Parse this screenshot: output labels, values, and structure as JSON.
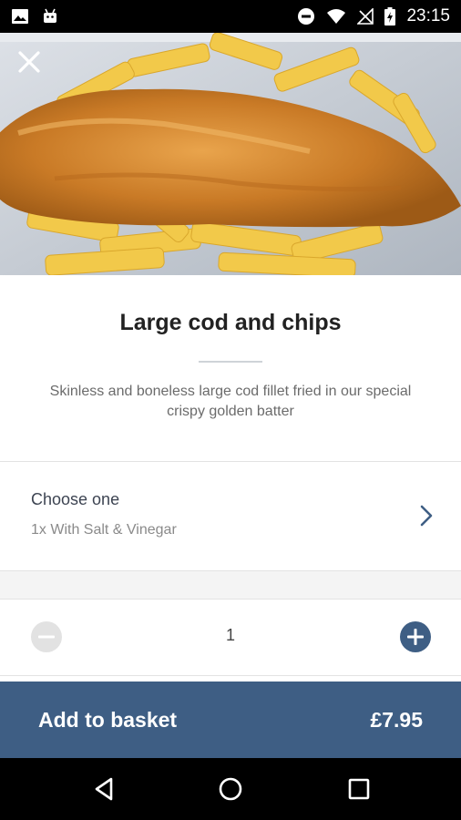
{
  "status_bar": {
    "time": "23:15",
    "left_icons": [
      "gallery-icon",
      "android-icon"
    ],
    "right_icons": [
      "do-not-disturb-icon",
      "wifi-icon",
      "no-signal-icon",
      "battery-charging-icon"
    ]
  },
  "hero": {
    "image": "fish-and-chips-photo",
    "close_icon": "close-icon"
  },
  "product": {
    "title": "Large cod and chips",
    "description": "Skinless and boneless large cod fillet fried in our special crispy golden batter"
  },
  "option": {
    "title": "Choose one",
    "value": "1x With Salt & Vinegar",
    "icon": "chevron-right-icon"
  },
  "quantity": {
    "value": "1",
    "minus_icon": "minus-circle-icon",
    "plus_icon": "plus-circle-icon",
    "minus_enabled": false
  },
  "basket": {
    "label": "Add to basket",
    "price": "£7.95"
  },
  "nav_bar": {
    "icons": [
      "back-icon",
      "home-icon",
      "recents-icon"
    ]
  },
  "colors": {
    "accent": "#3e5e84",
    "text_dark": "#222222",
    "text_muted": "#8a8a8a",
    "disabled": "#e2e2e2"
  }
}
